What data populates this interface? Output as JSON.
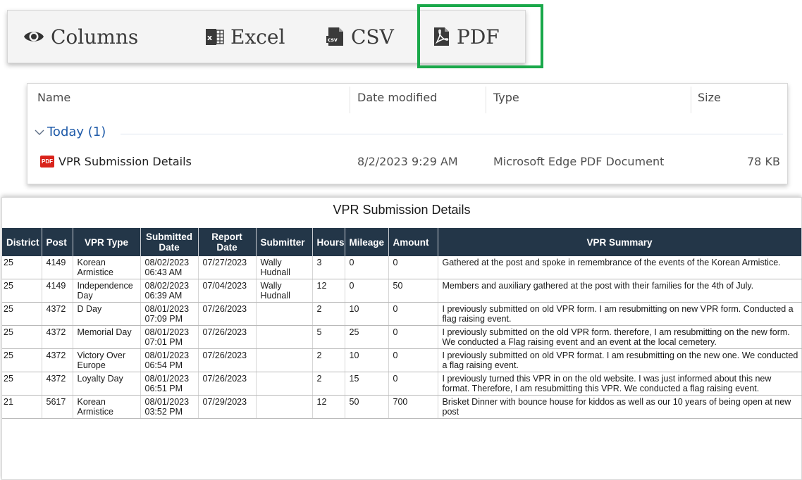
{
  "toolbar": {
    "columns_label": "Columns",
    "excel_label": "Excel",
    "csv_label": "CSV",
    "pdf_label": "PDF",
    "icons": [
      "eye-icon",
      "excel-icon",
      "csv-icon",
      "pdf-icon"
    ],
    "highlight_color": "#1aa84a"
  },
  "explorer": {
    "headers": {
      "name": "Name",
      "date_modified": "Date modified",
      "type": "Type",
      "size": "Size"
    },
    "group_label": "Today (1)",
    "file": {
      "name": "VPR Submission Details",
      "date_modified": "8/2/2023 9:29 AM",
      "type": "Microsoft Edge PDF Document",
      "size": "78 KB",
      "icon_text": "PDF"
    }
  },
  "report": {
    "title": "VPR Submission Details",
    "header_color": "#233648",
    "columns": [
      "District",
      "Post",
      "VPR Type",
      "Submitted Date",
      "Report Date",
      "Submitter",
      "Hours",
      "Mileage",
      "Amount",
      "VPR Summary"
    ],
    "rows": [
      {
        "district": "25",
        "post": "4149",
        "vpr_type": "Korean Armistice",
        "submitted": "08/02/2023 06:43 AM",
        "report_date": "07/27/2023",
        "submitter": "Wally Hudnall",
        "hours": "3",
        "mileage": "0",
        "amount": "0",
        "summary": "Gathered at the post and spoke in remembrance of the events of the Korean Armistice."
      },
      {
        "district": "25",
        "post": "4149",
        "vpr_type": "Independence Day",
        "submitted": "08/02/2023 06:39 AM",
        "report_date": "07/04/2023",
        "submitter": "Wally Hudnall",
        "hours": "12",
        "mileage": "0",
        "amount": "50",
        "summary": "Members and auxiliary gathered at the post with their families for the 4th of July."
      },
      {
        "district": "25",
        "post": "4372",
        "vpr_type": "D Day",
        "submitted": "08/01/2023 07:09 PM",
        "report_date": "07/26/2023",
        "submitter": "",
        "hours": "2",
        "mileage": "10",
        "amount": "0",
        "summary": "I previously submitted on old VPR form. I am resubmitting on new VPR form.  Conducted a flag raising event."
      },
      {
        "district": "25",
        "post": "4372",
        "vpr_type": "Memorial Day",
        "submitted": "08/01/2023 07:01 PM",
        "report_date": "07/26/2023",
        "submitter": "",
        "hours": "5",
        "mileage": "25",
        "amount": "0",
        "summary": "I previously submitted on the old VPR form. therefore, I am resubmitting on the new form.  We conducted a Flag raising event and an event at the local cemetery."
      },
      {
        "district": "25",
        "post": "4372",
        "vpr_type": "Victory Over Europe",
        "submitted": "08/01/2023 06:54 PM",
        "report_date": "07/26/2023",
        "submitter": "",
        "hours": "2",
        "mileage": "10",
        "amount": "0",
        "summary": "I previously submitted on old VPR format. I am resubmitting on the new one.  We conducted a flag raising event."
      },
      {
        "district": "25",
        "post": "4372",
        "vpr_type": "Loyalty Day",
        "submitted": "08/01/2023 06:51 PM",
        "report_date": "07/26/2023",
        "submitter": "",
        "hours": "2",
        "mileage": "15",
        "amount": "0",
        "summary": "I previously turned this VPR in on the old website. I was just informed about this new format. Therefore, I am resubmitting this VPR. We conducted a flag raising event."
      },
      {
        "district": "21",
        "post": "5617",
        "vpr_type": "Korean Armistice",
        "submitted": "08/01/2023 03:52 PM",
        "report_date": "07/29/2023",
        "submitter": "",
        "hours": "12",
        "mileage": "50",
        "amount": "700",
        "summary": "Brisket Dinner with bounce house for kiddos as well as our 10 years of being open at new post"
      }
    ]
  }
}
